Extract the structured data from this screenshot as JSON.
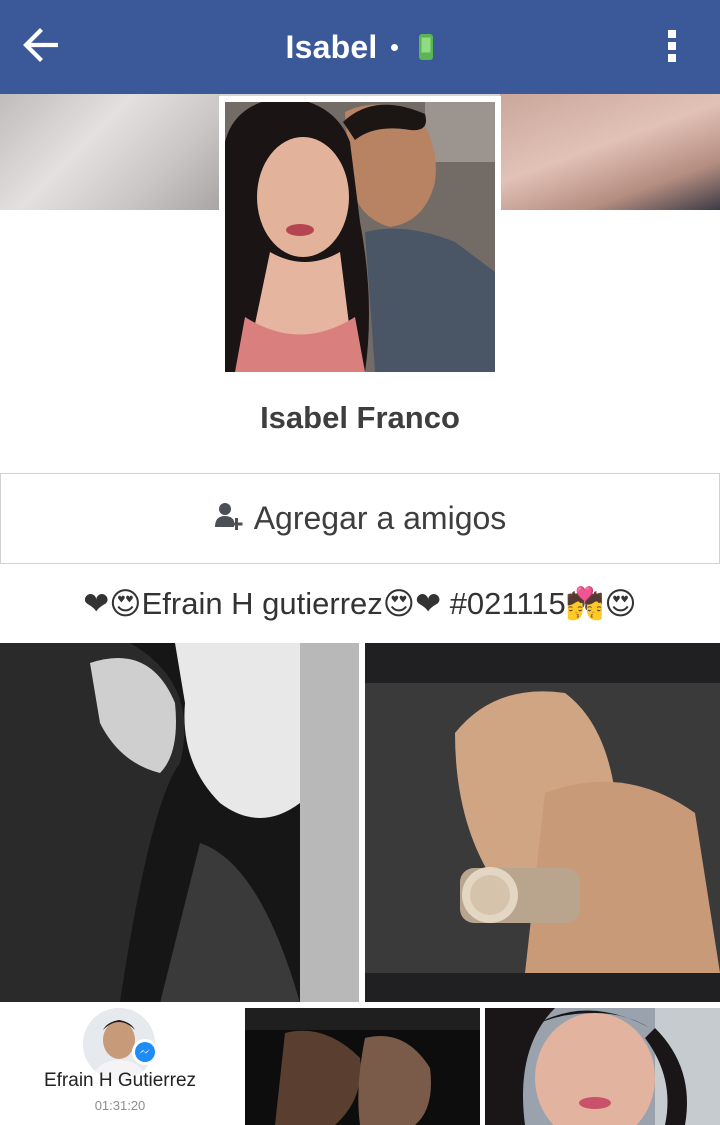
{
  "header": {
    "title": "Isabel",
    "back_icon": "arrow-left-icon",
    "status_icon": "mobile-phone-icon",
    "menu_icon": "more-vertical-icon",
    "background": "#3b5998",
    "status_color": "#5ab552"
  },
  "profile": {
    "name": "Isabel Franco",
    "add_friend_label": "Agregar a amigos",
    "add_friend_icon": "add-friend-icon",
    "bio": "❤😍Efrain H gutierrez😍❤ #021115💏😍"
  },
  "chat_head": {
    "name": "Efrain H Gutierrez",
    "time": "01:31:20",
    "badge_icon": "messenger-icon"
  }
}
